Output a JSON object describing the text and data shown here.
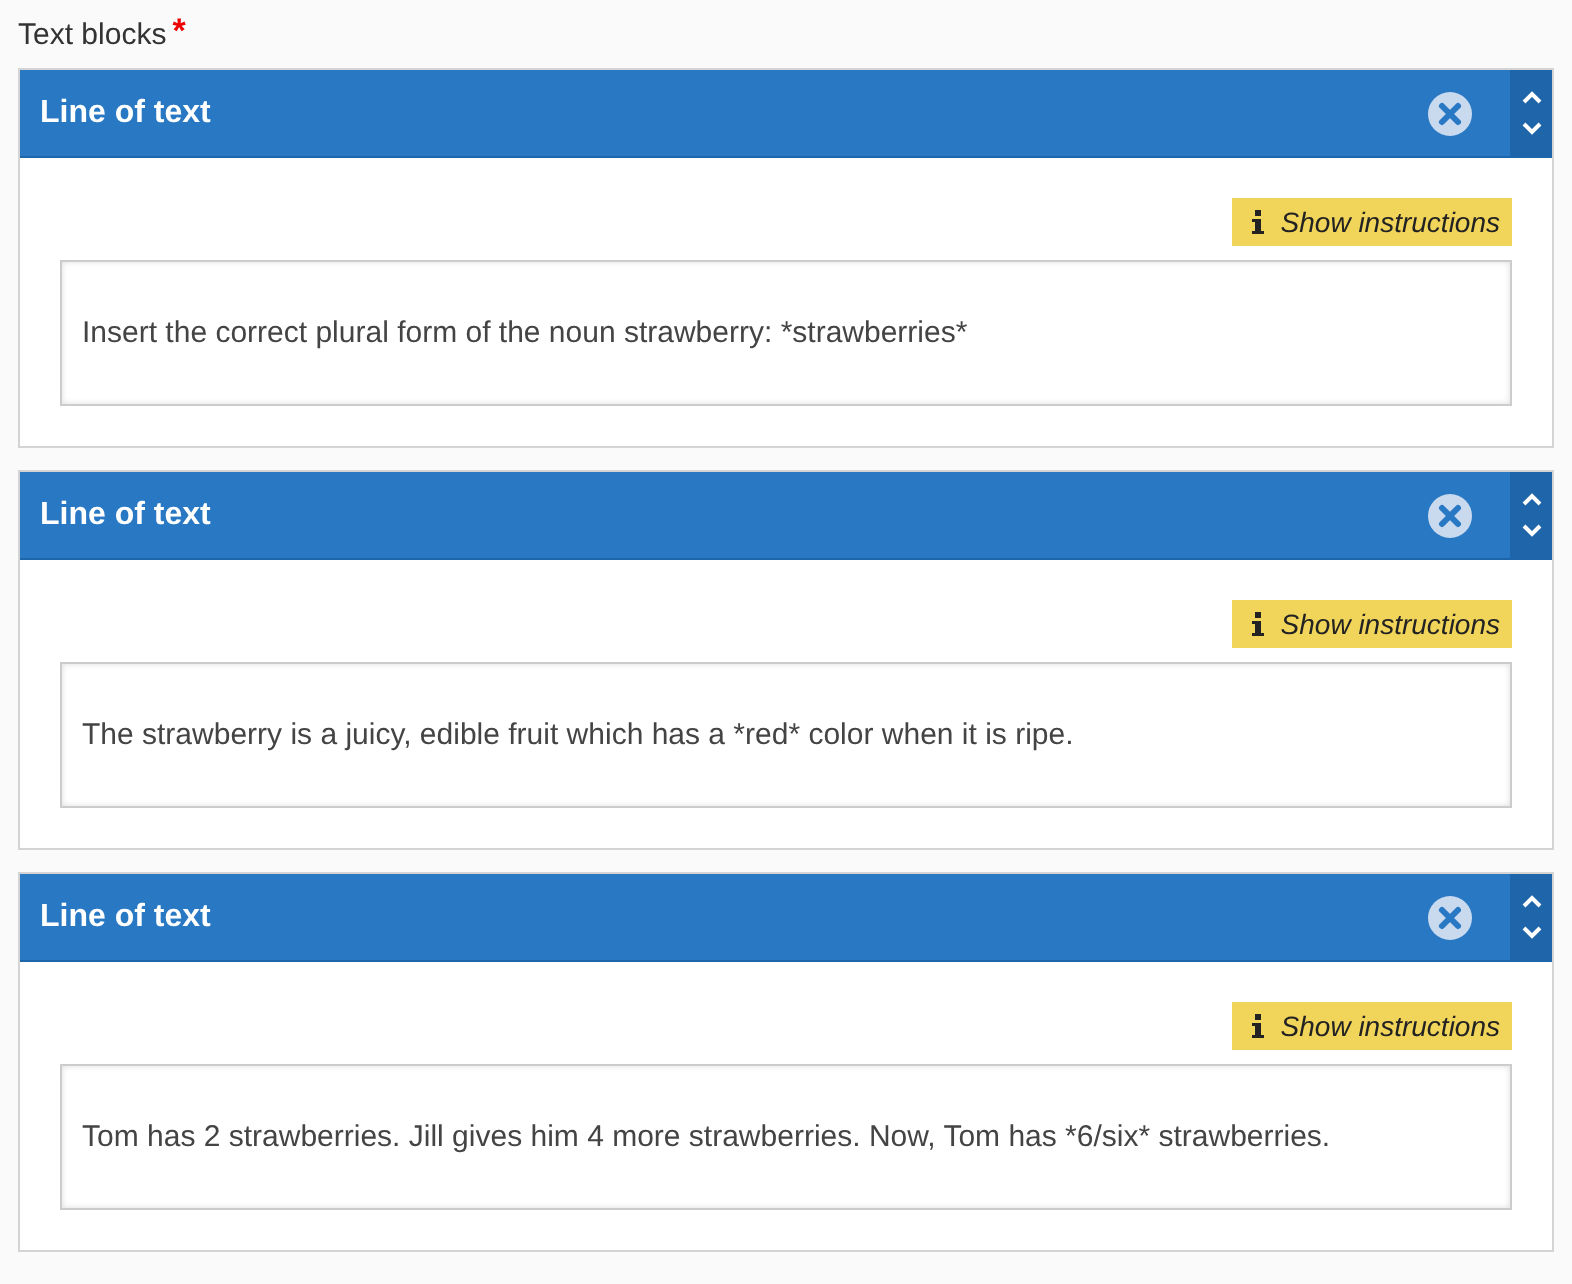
{
  "label": "Text blocks",
  "required_mark": "*",
  "blocks": [
    {
      "title": "Line of text",
      "instructions_button": "Show instructions",
      "text": "Insert the correct plural form of the noun strawberry: *strawberries*"
    },
    {
      "title": "Line of text",
      "instructions_button": "Show instructions",
      "text": "The strawberry is a juicy, edible fruit which has a *red* color when it is ripe."
    },
    {
      "title": "Line of text",
      "instructions_button": "Show instructions",
      "text": "Tom has 2 strawberries. Jill gives him 4 more strawberries. Now, Tom has *6/six* strawberries."
    }
  ]
}
